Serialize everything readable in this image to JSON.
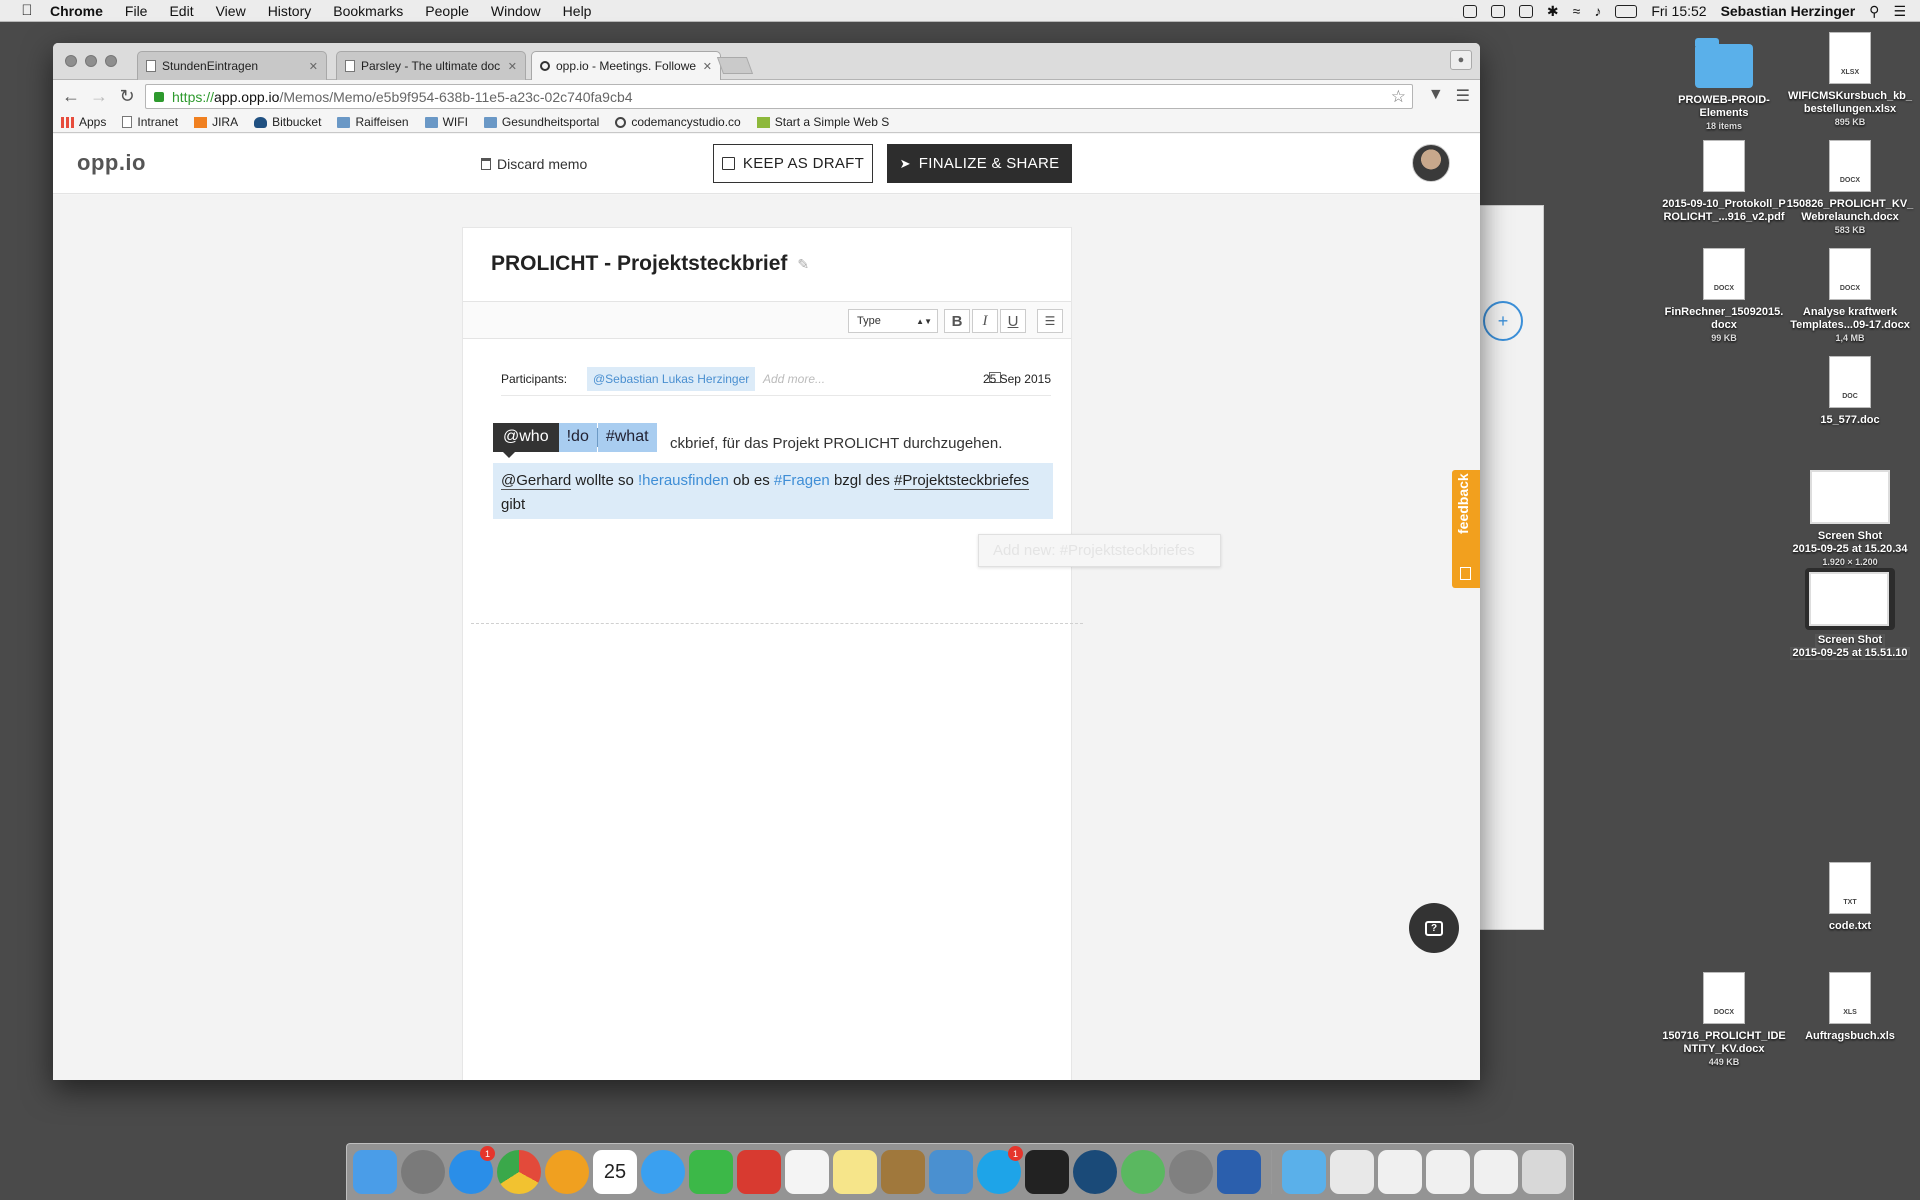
{
  "menubar": {
    "app": "Chrome",
    "items": [
      "File",
      "Edit",
      "View",
      "History",
      "Bookmarks",
      "People",
      "Window",
      "Help"
    ],
    "clock": "Fri 15:52",
    "user": "Sebastian Herzinger"
  },
  "desktop": {
    "icons": [
      {
        "name": "PROWEB-PROID-Elements",
        "line1": "PROWEB-PROID-",
        "line2": "Elements",
        "sub": "18 items",
        "kind": "folder"
      },
      {
        "name": "WIFICMSKursbuch_kb_bestellungen.xlsx",
        "line1": "WIFICMSKursbuch_kb_",
        "line2": "bestellungen.xlsx",
        "sub": "895 KB",
        "kind": "xlsx",
        "tag": "XLSX"
      },
      {
        "line1": "2015-09-10_Protokoll_P",
        "line2": "ROLICHT_...916_v2.pdf",
        "sub": "",
        "kind": "pdf",
        "tag": ""
      },
      {
        "line1": "150826_PROLICHT_KV_",
        "line2": "Webrelaunch.docx",
        "sub": "583 KB",
        "kind": "docx",
        "tag": "DOCX"
      },
      {
        "line1": "FinRechner_15092015.",
        "line2": "docx",
        "sub": "99 KB",
        "kind": "docx",
        "tag": "DOCX"
      },
      {
        "line1": "Analyse kraftwerk",
        "line2": "Templates...09-17.docx",
        "sub": "1,4 MB",
        "kind": "docx",
        "tag": "DOCX"
      },
      {
        "line1": "15_577.doc",
        "line2": "",
        "sub": "",
        "kind": "doc",
        "tag": "DOC"
      },
      {
        "line1": "Screen Shot",
        "line2": "2015-09-25 at 15.20.34",
        "sub": "1.920 × 1.200",
        "kind": "shot"
      },
      {
        "line1": "Screen Shot",
        "line2": "2015-09-25 at 15.51.10",
        "sub": "",
        "kind": "shot-selected"
      },
      {
        "line1": "code.txt",
        "line2": "",
        "sub": "",
        "kind": "txt",
        "tag": "TXT"
      },
      {
        "line1": "150716_PROLICHT_IDE",
        "line2": "NTITY_KV.docx",
        "sub": "449 KB",
        "kind": "docx",
        "tag": "DOCX"
      },
      {
        "line1": "Auftragsbuch.xls",
        "line2": "",
        "sub": "",
        "kind": "xls",
        "tag": "XLS"
      }
    ]
  },
  "browser": {
    "tabs": [
      {
        "label": "StundenEintragen",
        "active": false
      },
      {
        "label": "Parsley - The ultimate doc",
        "active": false
      },
      {
        "label": "opp.io - Meetings. Followe",
        "active": true
      }
    ],
    "url": {
      "scheme": "https://",
      "host": "app.opp.io",
      "path": "/Memos/Memo/e5b9f954-638b-11e5-a23c-02c740fa9cb4"
    },
    "bookmarks": [
      {
        "label": "Apps",
        "icon": "grid"
      },
      {
        "label": "Intranet",
        "icon": "page"
      },
      {
        "label": "JIRA",
        "icon": "jira"
      },
      {
        "label": "Bitbucket",
        "icon": "bucket"
      },
      {
        "label": "Raiffeisen",
        "icon": "folder"
      },
      {
        "label": "WIFI",
        "icon": "folder"
      },
      {
        "label": "Gesundheitsportal",
        "icon": "folder"
      },
      {
        "label": "codemancystudio.co",
        "icon": "gear"
      },
      {
        "label": "Start a Simple Web S",
        "icon": "h"
      }
    ]
  },
  "app": {
    "logo": "opp.io",
    "discard_label": "Discard memo",
    "keep_draft_label": "KEEP AS DRAFT",
    "finalize_label": "FINALIZE & SHARE",
    "memo": {
      "title": "PROLICHT - Projektsteckbrief",
      "type_select": "Type",
      "format_buttons": {
        "bold": "B",
        "italic": "I",
        "underline": "U"
      },
      "participants_label": "Participants:",
      "participant": "@Sebastian Lukas Herzinger",
      "add_more": "Add more...",
      "date": "25 Sep 2015",
      "autocomplete": {
        "who": "@who",
        "do": "!do",
        "what": "#what"
      },
      "line1_rest": "ckbrief, für das Projekt PROLICHT durchzugehen.",
      "para": {
        "mention": "@Gerhard",
        "t1": " wollte so ",
        "todo": "!herausfinden",
        "t2": " ob es ",
        "tag1": "#Fragen",
        "t3": " bzgl des ",
        "tag2": "#Projektsteckbriefes",
        "t4": "gibt"
      },
      "suggestion": "Add new: #Projektsteckbriefes"
    },
    "feedback_label": "feedback",
    "help_label": "?"
  },
  "dock": {
    "apps": [
      {
        "name": "finder",
        "color": "#4a9de8"
      },
      {
        "name": "launchpad",
        "color": "#7a7a7a"
      },
      {
        "name": "app-store",
        "color": "#2a8ee8",
        "badge": "1"
      },
      {
        "name": "chrome",
        "color": "#e8c030"
      },
      {
        "name": "opera",
        "color": "#f0a020"
      },
      {
        "name": "calendar",
        "color": "#ffffff",
        "label": "25"
      },
      {
        "name": "messages",
        "color": "#3aa0f0"
      },
      {
        "name": "facetime",
        "color": "#3cb848"
      },
      {
        "name": "wunderlist",
        "color": "#d83a30"
      },
      {
        "name": "reminders",
        "color": "#f4f4f4"
      },
      {
        "name": "notes",
        "color": "#f6e58a"
      },
      {
        "name": "contacts",
        "color": "#a0783c"
      },
      {
        "name": "tweetbot",
        "color": "#4a90d0"
      },
      {
        "name": "skype",
        "color": "#1ea4e8",
        "badge": "1"
      },
      {
        "name": "terminal",
        "color": "#222222"
      },
      {
        "name": "sourcetree",
        "color": "#1a4a78"
      },
      {
        "name": "atom",
        "color": "#5ab860"
      },
      {
        "name": "system-preferences",
        "color": "#808080"
      },
      {
        "name": "word",
        "color": "#2b5fad"
      }
    ]
  }
}
